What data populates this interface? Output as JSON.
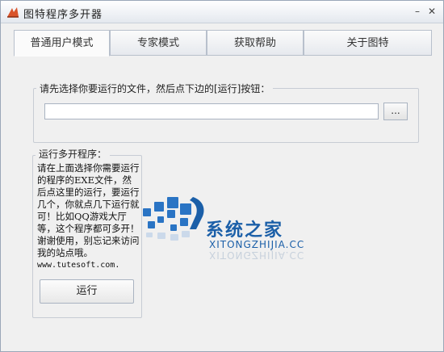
{
  "window": {
    "title": "图特程序多开器",
    "minimize_label": "–",
    "close_label": "✕"
  },
  "tabs": [
    {
      "label": "普通用户模式",
      "active": true
    },
    {
      "label": "专家模式",
      "active": false
    },
    {
      "label": "获取帮助",
      "active": false
    },
    {
      "label": "关于图特",
      "active": false
    }
  ],
  "file_group": {
    "legend": "请先选择你要运行的文件，然后点下边的[运行]按钮：",
    "file_value": "",
    "browse_label": "..."
  },
  "run_group": {
    "legend": "运行多开程序：",
    "description": "请在上面选择你需要运行的程序的EXE文件，然后点这里的运行，要运行几个，你就点几下运行就可！比如QQ游戏大厅等，这个程序都可多开！谢谢使用，别忘记来访问我的站点哦。",
    "url": "www.tutesoft.com.",
    "run_label": "运行"
  },
  "watermark": {
    "title": "系统之家",
    "subtitle": "XITONGZHIJIA.CC",
    "color": "#1b5fa8"
  }
}
